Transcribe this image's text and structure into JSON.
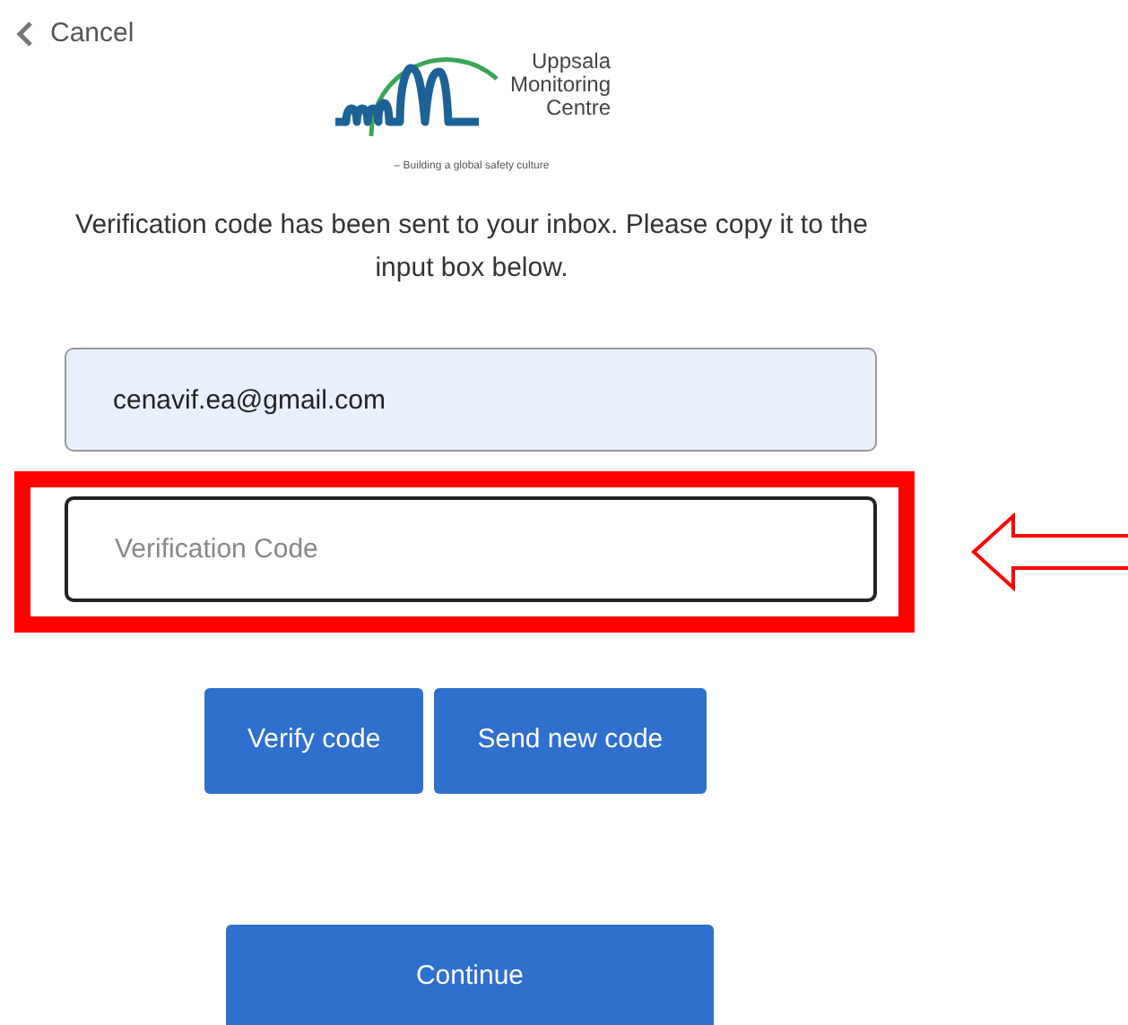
{
  "cancel": {
    "label": "Cancel"
  },
  "logo": {
    "name_lines": [
      "Uppsala",
      "Monitoring",
      "Centre"
    ],
    "tagline": "– Building a global safety culture"
  },
  "message": "Verification code has been sent to your inbox. Please copy it to the input box below.",
  "email_field": {
    "value": "cenavif.ea@gmail.com"
  },
  "code_field": {
    "placeholder": "Verification Code",
    "highlighted": true
  },
  "buttons": [
    {
      "label": "Verify code"
    },
    {
      "label": "Send new code"
    }
  ],
  "continue_button": {
    "label": "Continue"
  }
}
